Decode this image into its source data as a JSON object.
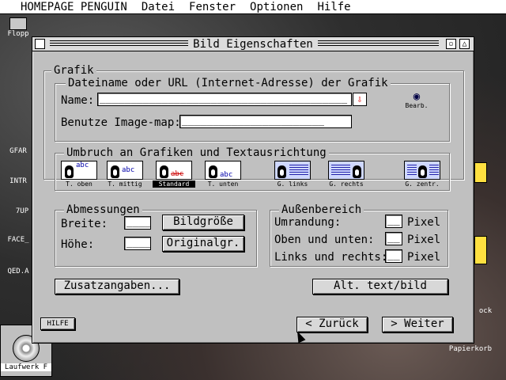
{
  "menubar": {
    "app": "HOMEPAGE PENGUIN",
    "items": [
      "Datei",
      "Fenster",
      "Optionen",
      "Hilfe"
    ]
  },
  "desktop": {
    "icons": {
      "floppy": "Flopp",
      "gfar": "GFAR",
      "intr": "INTR",
      "zup": "7UP",
      "face": "FACE_",
      "qed": "QED.A",
      "drive": "Laufwerk F",
      "trash": "Papierkorb",
      "ock": "ock"
    }
  },
  "window": {
    "title": "Bild Eigenschaften",
    "grafik": {
      "group_label": "Grafik",
      "sub_label": "Dateiname oder URL (Internet-Adresse) der Grafik",
      "name_label": "Name:",
      "name_value": "________________________________________",
      "edit_label": "Bearb.",
      "imagemap_label": "Benutze Image-map:",
      "imagemap_value": "_______________________"
    },
    "umbruch": {
      "group_label": "Umbruch an Grafiken und Textausrichtung",
      "options": [
        "T. oben",
        "T. mittig",
        "Standard",
        "T. unten",
        "G. links",
        "G. rechts",
        "G. zentr."
      ],
      "selected": "Standard"
    },
    "abmessungen": {
      "group_label": "Abmessungen",
      "breite_label": "Breite:",
      "breite_value": "____",
      "hoehe_label": "Höhe:",
      "hoehe_value": "____",
      "bildgroesse_button": "Bildgröße",
      "originalgr_button": "Originalgr."
    },
    "aussenbereich": {
      "group_label": "Außenbereich",
      "umrandung_label": "Umrandung:",
      "umrandung_value": "__",
      "oben_label": "Oben und unten:",
      "oben_value": "__",
      "links_label": "Links und rechts:",
      "links_value": "__",
      "unit": "Pixel"
    },
    "buttons": {
      "zusatz": "Zusatzangaben...",
      "alt": "Alt. text/bild",
      "hilfe": "HILFE",
      "zurueck": "< Zurück",
      "weiter": "> Weiter"
    }
  }
}
